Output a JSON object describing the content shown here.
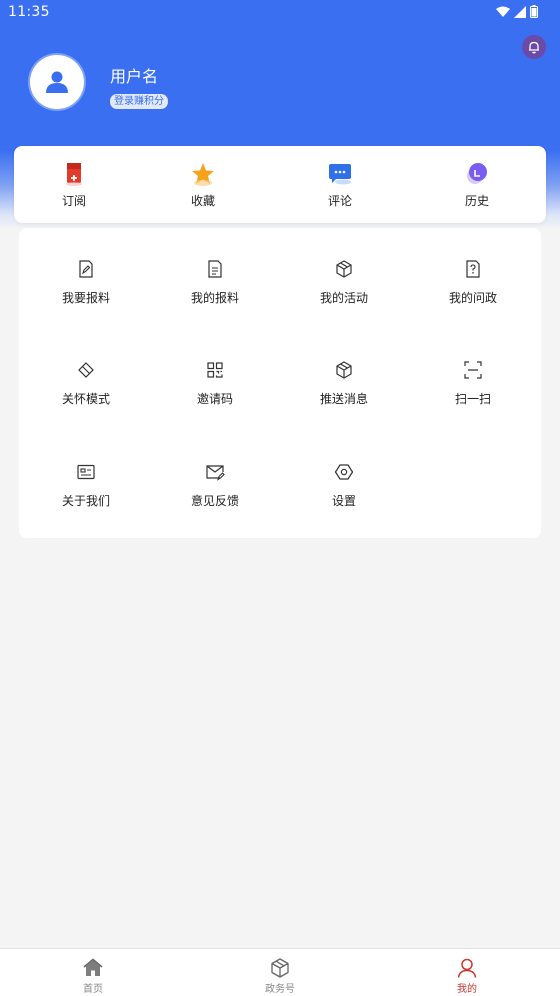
{
  "status_bar": {
    "time": "11:35"
  },
  "profile": {
    "username": "用户名",
    "login_hint": "登录赚积分"
  },
  "quick_actions": [
    {
      "label": "订阅",
      "icon": "subscribe-icon"
    },
    {
      "label": "收藏",
      "icon": "star-icon"
    },
    {
      "label": "评论",
      "icon": "comment-icon"
    },
    {
      "label": "历史",
      "icon": "history-icon"
    }
  ],
  "menu": [
    {
      "label": "我要报料",
      "icon": "edit-document-icon"
    },
    {
      "label": "我的报料",
      "icon": "document-icon"
    },
    {
      "label": "我的活动",
      "icon": "cube-icon"
    },
    {
      "label": "我的问政",
      "icon": "question-document-icon"
    },
    {
      "label": "关怀模式",
      "icon": "care-icon"
    },
    {
      "label": "邀请码",
      "icon": "grid-icon"
    },
    {
      "label": "推送消息",
      "icon": "cube-icon"
    },
    {
      "label": "扫一扫",
      "icon": "scan-icon"
    },
    {
      "label": "关于我们",
      "icon": "id-card-icon"
    },
    {
      "label": "意见反馈",
      "icon": "mail-edit-icon"
    },
    {
      "label": "设置",
      "icon": "hexagon-settings-icon"
    }
  ],
  "bottom_nav": [
    {
      "label": "首页",
      "icon": "home-icon"
    },
    {
      "label": "政务号",
      "icon": "cube-icon"
    },
    {
      "label": "我的",
      "icon": "person-icon",
      "active": true
    }
  ],
  "colors": {
    "brand": "#3a6ff2",
    "active_tab": "#c5392f"
  }
}
